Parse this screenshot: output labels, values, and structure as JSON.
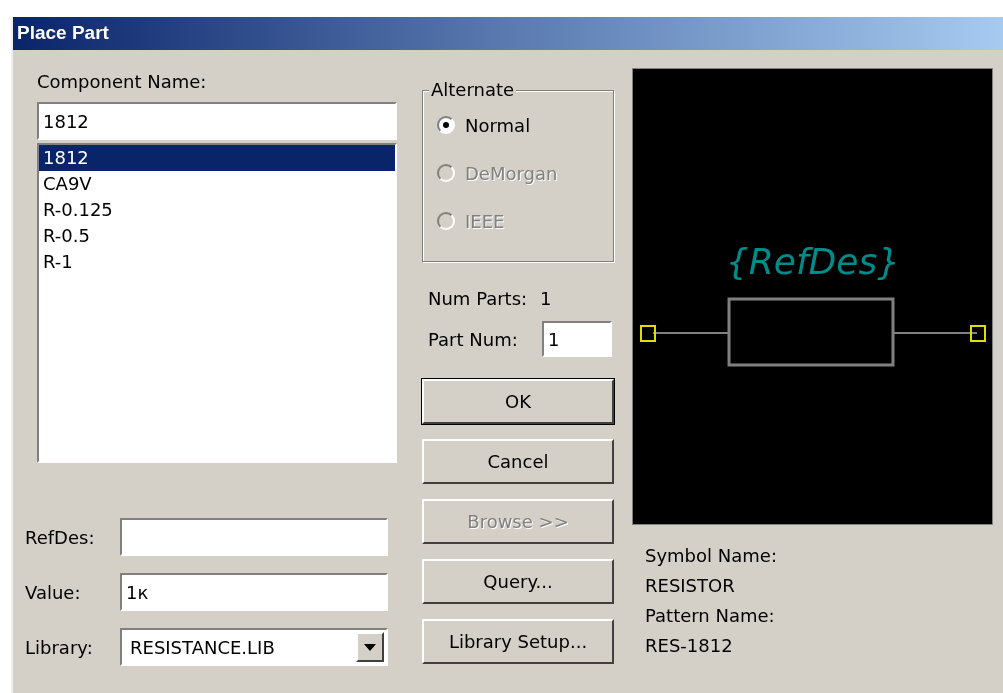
{
  "window": {
    "title": "Place Part"
  },
  "component_name": {
    "label": "Component Name:",
    "value": "1812"
  },
  "components": [
    {
      "name": "1812",
      "selected": true
    },
    {
      "name": "CA9V",
      "selected": false
    },
    {
      "name": "R-0.125",
      "selected": false
    },
    {
      "name": "R-0.5",
      "selected": false
    },
    {
      "name": "R-1",
      "selected": false
    }
  ],
  "alternate": {
    "title": "Alternate",
    "options": [
      {
        "label": "Normal",
        "selected": true,
        "disabled": false
      },
      {
        "label": "DeMorgan",
        "selected": false,
        "disabled": true
      },
      {
        "label": "IEEE",
        "selected": false,
        "disabled": true
      }
    ]
  },
  "num_parts": {
    "label": "Num Parts:",
    "value": "1"
  },
  "part_num": {
    "label": "Part Num:",
    "value": "1"
  },
  "buttons": [
    {
      "label": "OK",
      "default": true,
      "disabled": false
    },
    {
      "label": "Cancel",
      "default": false,
      "disabled": false
    },
    {
      "label": "Browse >>",
      "default": false,
      "disabled": true
    },
    {
      "label": "Query...",
      "default": false,
      "disabled": false
    },
    {
      "label": "Library Setup...",
      "default": false,
      "disabled": false
    }
  ],
  "fields": [
    {
      "kind": "text",
      "label": "RefDes:"
    },
    {
      "kind": "text",
      "label": "Value:",
      "value": "1к"
    },
    {
      "kind": "dropdown",
      "label": "Library:",
      "value": "RESISTANCE.LIB"
    }
  ],
  "preview": {
    "refdes_label": "{RefDes}"
  },
  "symbol_info": [
    "Symbol Name:",
    "RESISTOR",
    "Pattern Name:",
    "RES-1812"
  ]
}
